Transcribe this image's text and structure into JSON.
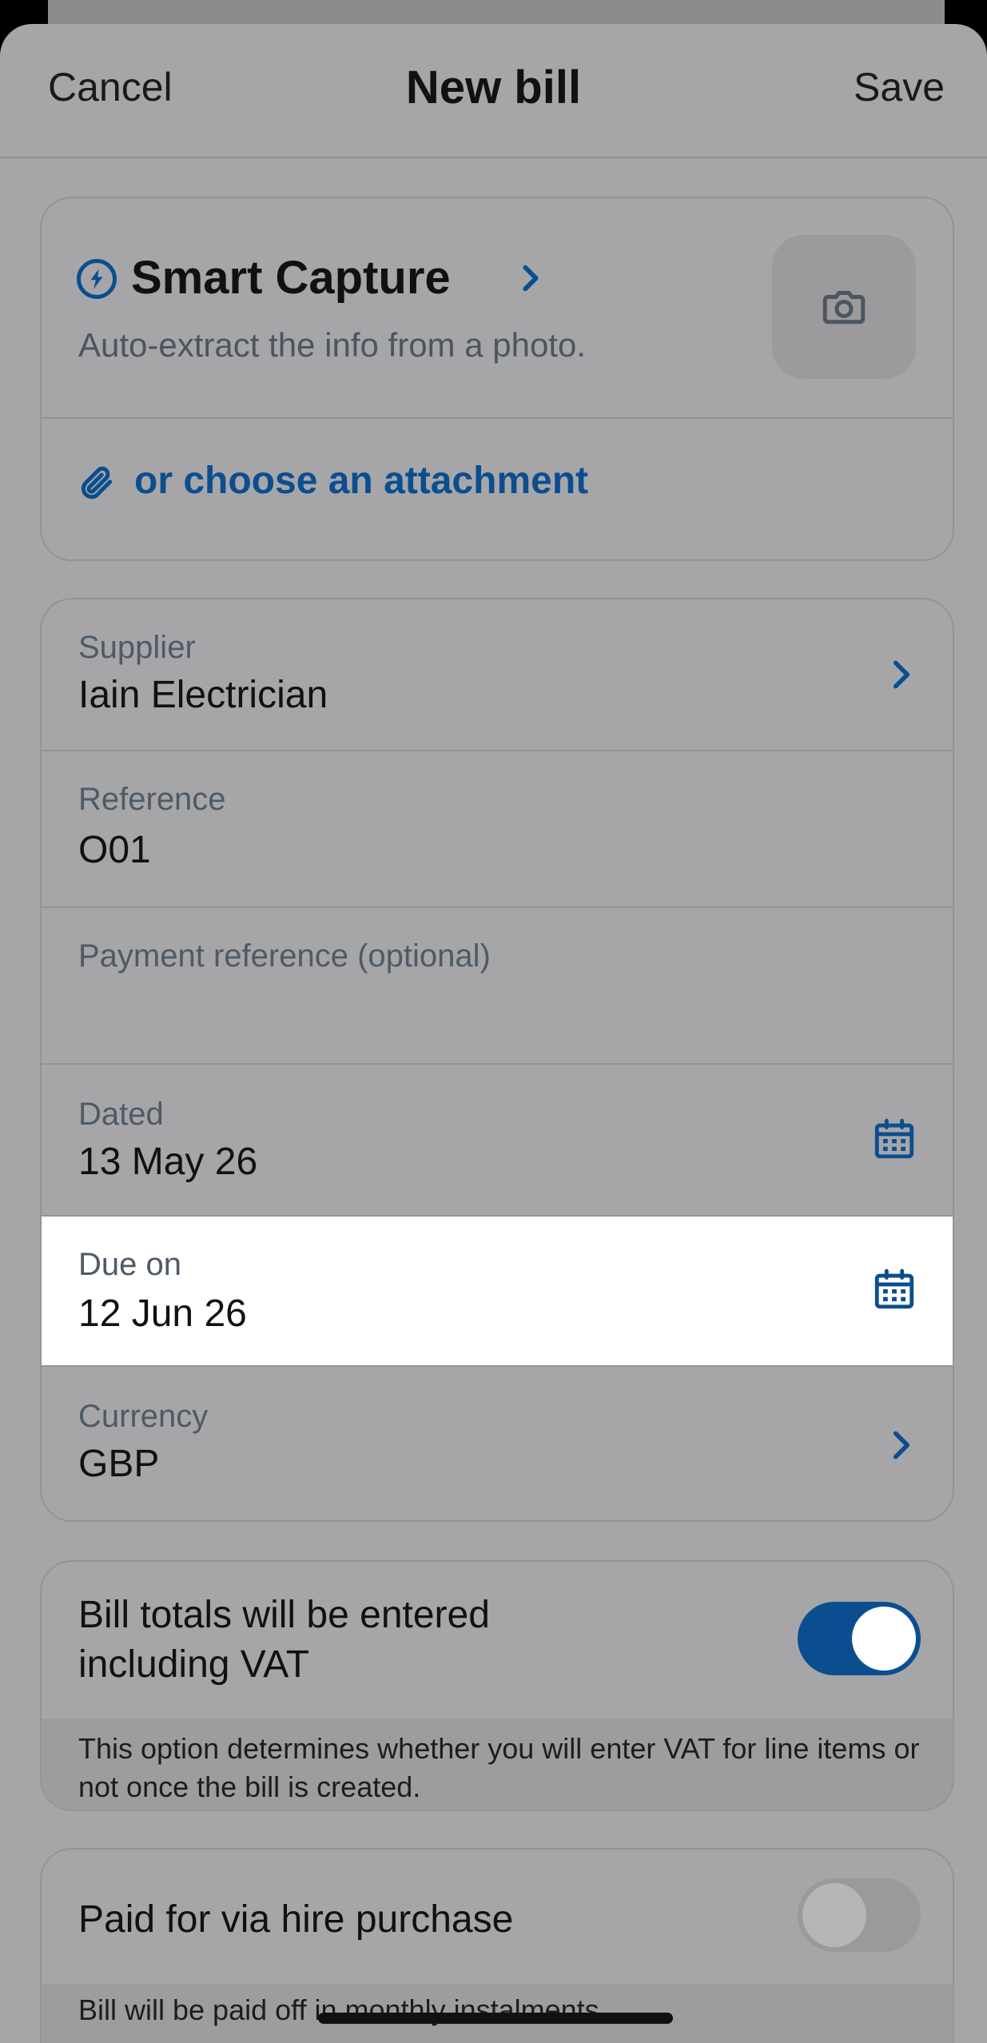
{
  "nav": {
    "cancel_label": "Cancel",
    "title": "New bill",
    "save_label": "Save"
  },
  "capture": {
    "title": "Smart Capture",
    "subtitle": "Auto-extract the info from a photo.",
    "attachment_label": "or choose an attachment",
    "icons": [
      "lightning-icon",
      "chevron-right-icon",
      "camera-icon",
      "paperclip-icon"
    ]
  },
  "form": {
    "supplier": {
      "label": "Supplier",
      "value": "Iain Electrician"
    },
    "reference": {
      "label": "Reference",
      "value": "O01"
    },
    "payment_reference": {
      "label": "Payment reference (optional)",
      "value": ""
    },
    "dated": {
      "label": "Dated",
      "value": "13 May 26"
    },
    "due_on": {
      "label": "Due on",
      "value": "12 Jun 26"
    },
    "currency": {
      "label": "Currency",
      "value": "GBP"
    }
  },
  "vat": {
    "label": "Bill totals will be entered including VAT",
    "enabled": true,
    "note": "This option determines whether you will enter VAT for line items or not once the bill is created."
  },
  "hire_purchase": {
    "label": "Paid for via hire purchase",
    "enabled": false,
    "note": "Bill will be paid off in monthly instalments."
  },
  "colors": {
    "accent": "#0b4e8f",
    "sheet_background": "#a6a6a9",
    "highlight_row": "#ffffff"
  }
}
